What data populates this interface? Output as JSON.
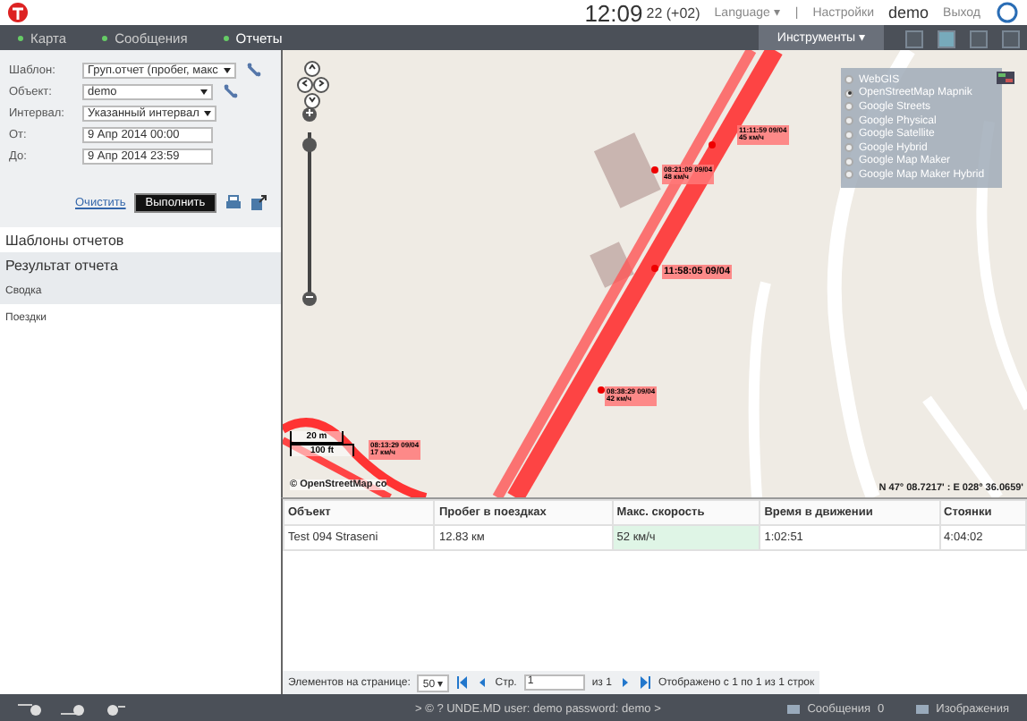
{
  "header": {
    "clock": "12:09",
    "seconds": "22 (+02)",
    "language": "Language ▾",
    "separator": "|",
    "settings": "Настройки",
    "user": "demo",
    "logout": "Выход"
  },
  "nav": {
    "tabs": [
      {
        "label": "Карта",
        "selected": false
      },
      {
        "label": "Сообщения",
        "selected": false
      },
      {
        "label": "Отчеты",
        "selected": true
      }
    ],
    "tools": "Инструменты ▾",
    "layouts": [
      {
        "selected": false
      },
      {
        "selected": true
      },
      {
        "selected": false
      },
      {
        "selected": false
      }
    ]
  },
  "form": {
    "fields": [
      {
        "label": "Шаблон:",
        "kind": "select",
        "value": "Груп.отчет (пробег, макс",
        "tool": true
      },
      {
        "label": "Объект:",
        "kind": "select",
        "value": "demo",
        "tool": true
      },
      {
        "label": "Интервал:",
        "kind": "select",
        "value": "Указанный интервал",
        "tool": false
      },
      {
        "label": "От:",
        "kind": "input",
        "value": "9 Апр 2014 00:00",
        "tool": false
      },
      {
        "label": "До:",
        "kind": "input",
        "value": "9 Апр 2014 23:59",
        "tool": false
      }
    ],
    "clear": "Очистить",
    "run": "Выполнить"
  },
  "sections": [
    {
      "label": "Шаблоны отчетов",
      "kind": "header",
      "selected": false
    },
    {
      "label": "Результат отчета",
      "kind": "header",
      "selected": true
    },
    {
      "label": "Сводка",
      "kind": "item",
      "selected": true
    },
    {
      "label": "Поездки",
      "kind": "item",
      "selected": false
    }
  ],
  "map": {
    "zoom": {
      "level": 0.97
    },
    "layers": [
      {
        "label": "WebGIS",
        "selected": false
      },
      {
        "label": "OpenStreetMap Mapnik",
        "selected": true
      },
      {
        "label": "Google Streets",
        "selected": false
      },
      {
        "label": "Google Physical",
        "selected": false
      },
      {
        "label": "Google Satellite",
        "selected": false
      },
      {
        "label": "Google Hybrid",
        "selected": false
      },
      {
        "label": "Google Map Maker",
        "selected": false
      },
      {
        "label": "Google Map Maker Hybrid",
        "selected": false
      }
    ],
    "track_labels": [
      {
        "time": "11:11:59 09/04",
        "speed": "45 км/ч"
      },
      {
        "time": "08:21:09 09/04",
        "speed": "48 км/ч"
      },
      {
        "time": "11:58:05 09/04"
      },
      {
        "time": "08:38:29 09/04",
        "speed": "42 км/ч"
      },
      {
        "time": "08:13:29 09/04",
        "speed": "17 км/ч"
      }
    ],
    "scale": [
      "20 m",
      "100 ft"
    ],
    "attribution": "© OpenStreetMap co",
    "coords": "N 47° 08.7217' : E 028° 36.0659'"
  },
  "table": {
    "columns": [
      "Объект",
      "Пробег в поездках",
      "Макс. скорость",
      "Время в движении",
      "Стоянки"
    ],
    "rows": [
      [
        {
          "text": "Test 094 Straseni",
          "highlighted": false
        },
        {
          "text": "12.83 км",
          "highlighted": false
        },
        {
          "text": "52 км/ч",
          "highlighted": true
        },
        {
          "text": "1:02:51",
          "highlighted": false
        },
        {
          "text": "4:04:02",
          "highlighted": false
        }
      ]
    ]
  },
  "pager": {
    "per_page_label": "Элементов на странице:",
    "per_page": "50 ▾",
    "page_label": "Стр.",
    "page": "1",
    "of": "из 1",
    "summary": "Отображено с 1 по 1 из 1 строк"
  },
  "footer": {
    "copyright": "> © ? UNDE.MD user: demo password: demo >",
    "messages": "Сообщения",
    "messages_count": "0",
    "images": "Изображения"
  }
}
